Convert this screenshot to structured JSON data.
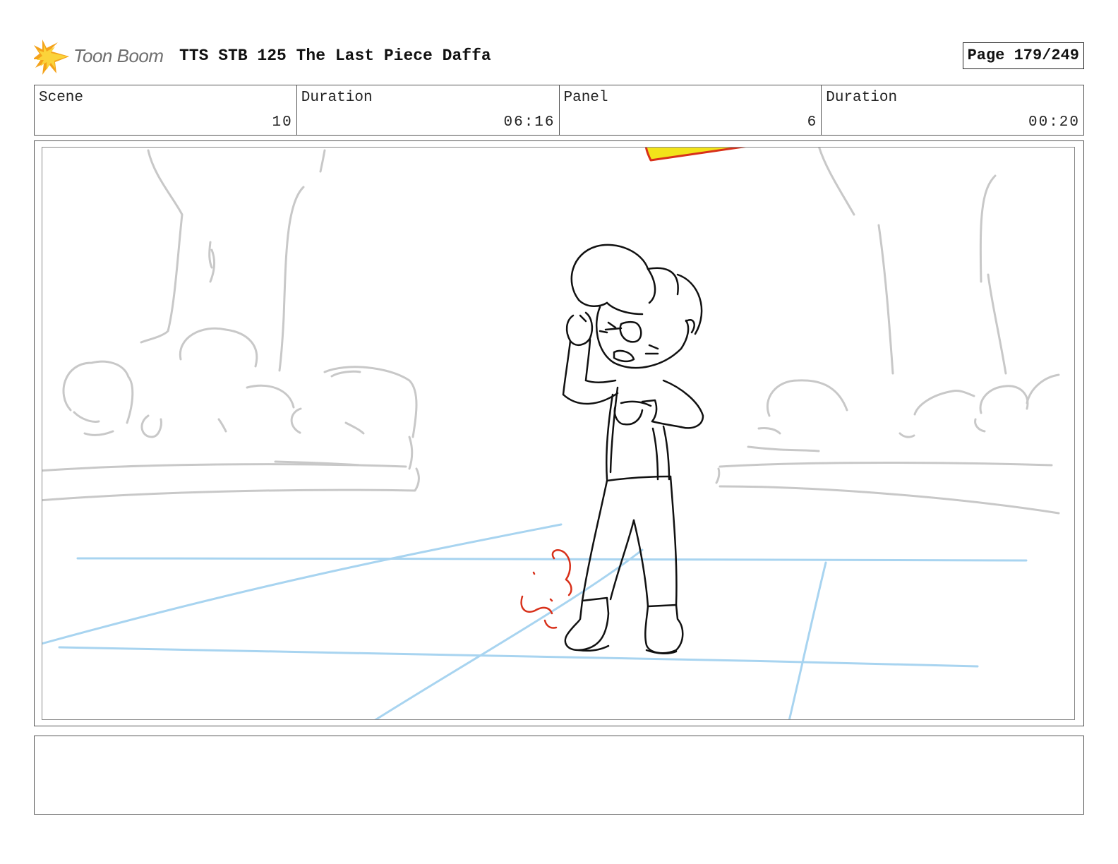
{
  "header": {
    "logo_text": "Toon Boom",
    "title": "TTS STB 125 The Last Piece Daffa",
    "page": "Page 179/249"
  },
  "info": {
    "scene_label": "Scene",
    "scene_value": "10",
    "scene_duration_label": "Duration",
    "scene_duration_value": "06:16",
    "panel_label": "Panel",
    "panel_value": "6",
    "panel_duration_label": "Duration",
    "panel_duration_value": "00:20"
  },
  "colors": {
    "background_sketch": "#c8c8c8",
    "floor_guides": "#a8d4f0",
    "character_lines": "#111111",
    "effect_red": "#d8301a",
    "effect_yellow": "#f2e31a",
    "logo_orange": "#f4a21a"
  },
  "notes": {
    "text": ""
  }
}
